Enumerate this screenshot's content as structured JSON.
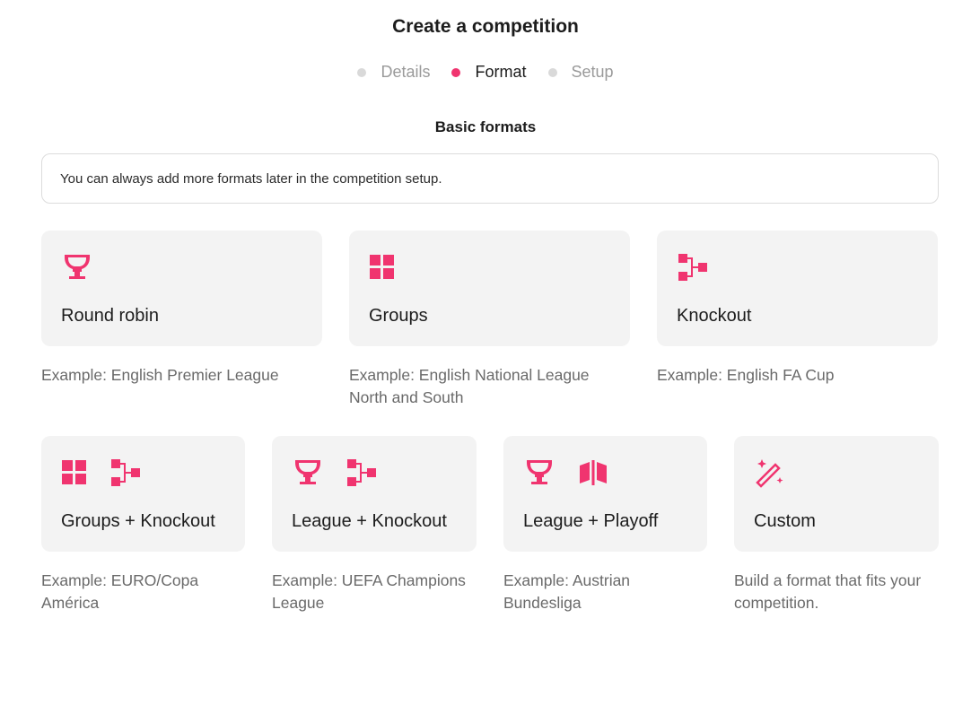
{
  "header": {
    "title": "Create a competition"
  },
  "stepper": {
    "steps": [
      "Details",
      "Format",
      "Setup"
    ],
    "active": "Format"
  },
  "section": {
    "title": "Basic formats"
  },
  "info": {
    "text": "You can always add more formats later in the competition setup."
  },
  "formats_row1": [
    {
      "label": "Round robin",
      "example": "Example: English Premier League",
      "icons": [
        "trophy-icon"
      ]
    },
    {
      "label": "Groups",
      "example": "Example: English National League North and South",
      "icons": [
        "grid-icon"
      ]
    },
    {
      "label": "Knockout",
      "example": "Example: English FA Cup",
      "icons": [
        "bracket-icon"
      ]
    }
  ],
  "formats_row2": [
    {
      "label": "Groups + Knockout",
      "example": "Example: EURO/Copa América",
      "icons": [
        "grid-icon",
        "bracket-icon"
      ]
    },
    {
      "label": "League + Knockout",
      "example": "Example: UEFA Champions League",
      "icons": [
        "trophy-icon",
        "bracket-icon"
      ]
    },
    {
      "label": "League + Playoff",
      "example": "Example: Austrian Bundesliga",
      "icons": [
        "trophy-icon",
        "playoff-icon"
      ]
    },
    {
      "label": "Custom",
      "example": "Build a format that fits your competition.",
      "icons": [
        "magic-wand-icon"
      ]
    }
  ],
  "colors": {
    "accent": "#f0346f",
    "card_bg": "#f3f3f3",
    "muted_text": "#6a6a6a"
  }
}
